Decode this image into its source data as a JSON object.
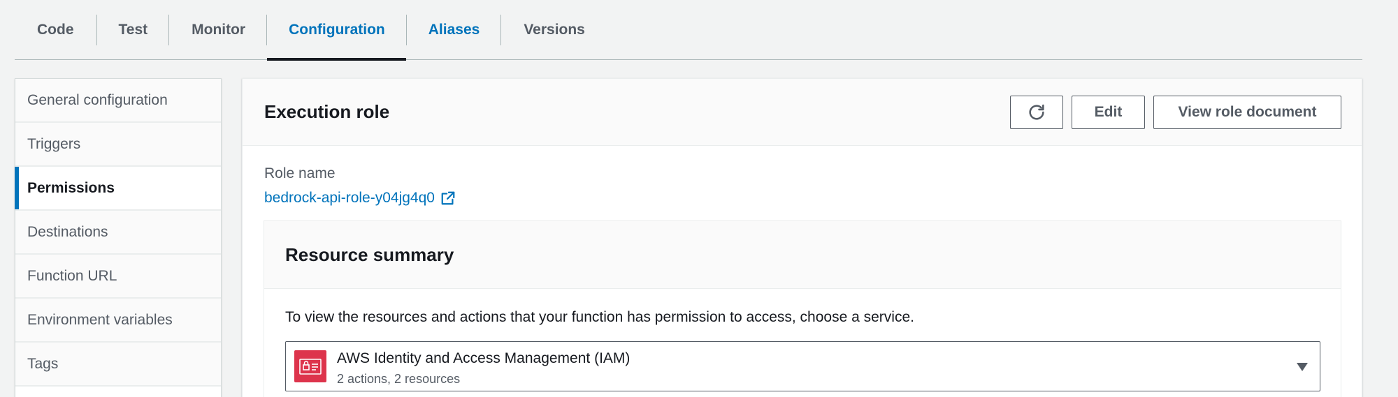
{
  "tabs": [
    {
      "label": "Code"
    },
    {
      "label": "Test"
    },
    {
      "label": "Monitor"
    },
    {
      "label": "Configuration"
    },
    {
      "label": "Aliases"
    },
    {
      "label": "Versions"
    }
  ],
  "sidebar": {
    "items": [
      {
        "label": "General configuration"
      },
      {
        "label": "Triggers"
      },
      {
        "label": "Permissions"
      },
      {
        "label": "Destinations"
      },
      {
        "label": "Function URL"
      },
      {
        "label": "Environment variables"
      },
      {
        "label": "Tags"
      }
    ],
    "active": "Permissions"
  },
  "execution_role": {
    "title": "Execution role",
    "edit_label": "Edit",
    "view_label": "View role document",
    "role_name_label": "Role name",
    "role_name": "bedrock-api-role-y04jg4q0"
  },
  "resource_summary": {
    "title": "Resource summary",
    "description": "To view the resources and actions that your function has permission to access, choose a service.",
    "service": {
      "name": "AWS Identity and Access Management (IAM)",
      "detail": "2 actions, 2 resources",
      "icon": "iam-icon"
    }
  },
  "colors": {
    "accent": "#0073bb",
    "iam": "#dd344c",
    "text": "#16191f",
    "muted": "#545b64"
  }
}
